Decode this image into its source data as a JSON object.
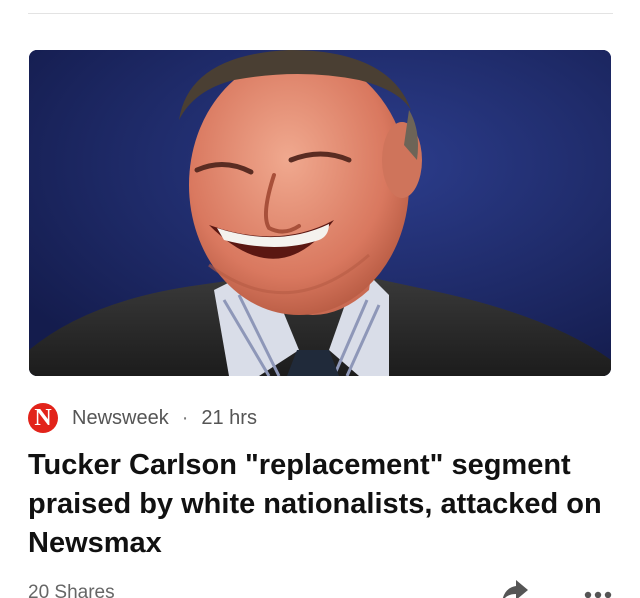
{
  "article": {
    "image_alt": "Tucker Carlson laughing",
    "source": {
      "logo_letter": "N",
      "name": "Newsweek",
      "separator": "·",
      "age": "21 hrs"
    },
    "headline": "Tucker Carlson \"replacement\" segment praised by white nationalists, attacked on Newsmax",
    "shares": "20 Shares"
  },
  "icons": {
    "share": "share-arrow-icon",
    "more": "ellipsis-icon",
    "source_logo": "newsweek-logo"
  },
  "colors": {
    "logo_red": "#e2231a",
    "image_background": "#1d2a66",
    "headline": "#111111",
    "meta_text": "#555555"
  }
}
